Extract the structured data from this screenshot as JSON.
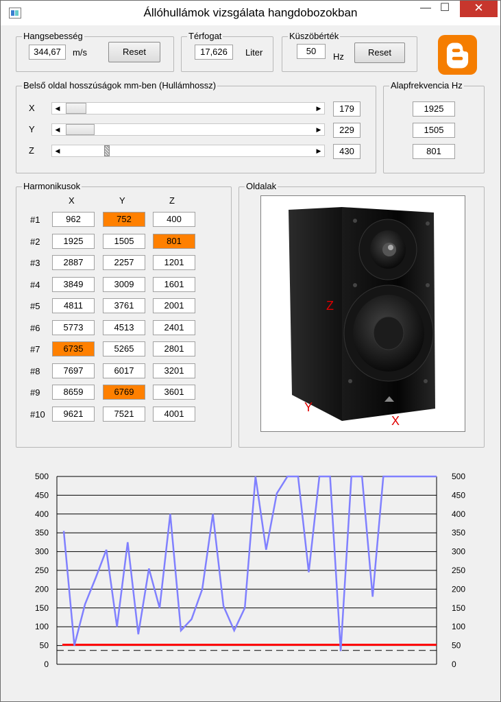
{
  "window": {
    "title": "Állóhullámok vizsgálata hangdobozokban",
    "min_glyph": "—",
    "max_glyph": "☐",
    "close_glyph": "✕"
  },
  "sound_speed": {
    "legend": "Hangsebesség",
    "value": "344,67",
    "unit": "m/s",
    "reset": "Reset"
  },
  "volume": {
    "legend": "Térfogat",
    "value": "17,626",
    "unit": "Liter"
  },
  "threshold": {
    "legend": "Küszöbérték",
    "value": "50",
    "unit": "Hz",
    "reset": "Reset"
  },
  "dimensions": {
    "legend": "Belső oldal hosszúságok mm-ben (Hullámhossz)",
    "rows": [
      {
        "label": "X",
        "value": "179"
      },
      {
        "label": "Y",
        "value": "229"
      },
      {
        "label": "Z",
        "value": "430"
      }
    ]
  },
  "fundamental": {
    "legend": "Alapfrekvencia Hz",
    "values": [
      "1925",
      "1505",
      "801"
    ]
  },
  "harmonics": {
    "legend": "Harmonikusok",
    "headers": [
      "X",
      "Y",
      "Z"
    ],
    "rows": [
      {
        "label": "#1",
        "cells": [
          "962",
          "752",
          "400"
        ]
      },
      {
        "label": "#2",
        "cells": [
          "1925",
          "1505",
          "801"
        ]
      },
      {
        "label": "#3",
        "cells": [
          "2887",
          "2257",
          "1201"
        ]
      },
      {
        "label": "#4",
        "cells": [
          "3849",
          "3009",
          "1601"
        ]
      },
      {
        "label": "#5",
        "cells": [
          "4811",
          "3761",
          "2001"
        ]
      },
      {
        "label": "#6",
        "cells": [
          "5773",
          "4513",
          "2401"
        ]
      },
      {
        "label": "#7",
        "cells": [
          "6735",
          "5265",
          "2801"
        ]
      },
      {
        "label": "#8",
        "cells": [
          "7697",
          "6017",
          "3201"
        ]
      },
      {
        "label": "#9",
        "cells": [
          "8659",
          "6769",
          "3601"
        ]
      },
      {
        "label": "#10",
        "cells": [
          "9621",
          "7521",
          "4001"
        ]
      }
    ],
    "highlight_color": "#ff8000"
  },
  "sides": {
    "legend": "Oldalak",
    "labels": {
      "z": "Z",
      "y": "Y",
      "x": "X"
    }
  },
  "colors": {
    "series": "#8080ff",
    "threshold": "#ff0000",
    "blogger": "#f57d00"
  },
  "icons": {
    "blogger": "blogger-logo-icon",
    "app": "app-window-icon"
  },
  "chart_data": {
    "type": "line",
    "ylim": [
      0,
      500
    ],
    "yticks": [
      "0",
      "50",
      "100",
      "150",
      "200",
      "250",
      "300",
      "350",
      "400",
      "450",
      "500"
    ],
    "grid": true,
    "series": [
      {
        "values": [
          355,
          50,
          160,
          230,
          305,
          100,
          325,
          80,
          255,
          150,
          400,
          90,
          120,
          200,
          400,
          155,
          90,
          150,
          500,
          305,
          455,
          500,
          500,
          245,
          500,
          500,
          35,
          500,
          500,
          180,
          500,
          500,
          500,
          500,
          500,
          500
        ]
      }
    ],
    "threshold_line": 52,
    "dashed_line": 37
  }
}
